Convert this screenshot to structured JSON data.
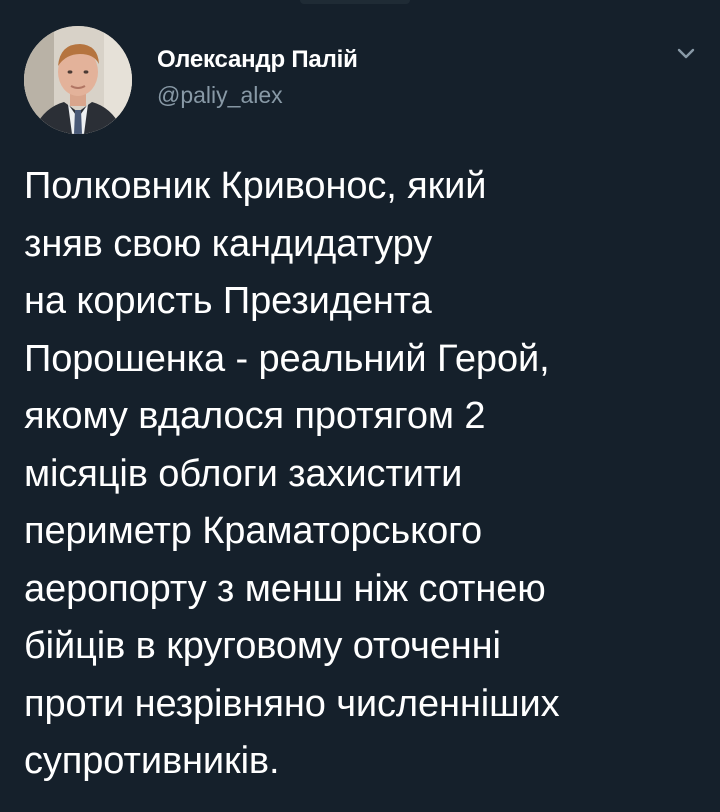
{
  "author": {
    "name": "Олександр Палій",
    "handle": "@paliy_alex",
    "avatar_icon": "user-avatar-photo"
  },
  "menu": {
    "icon": "chevron-down-icon"
  },
  "tweet": {
    "text": "Полковник Кривонос, який\nзняв свою кандидатуру\nна користь Президента\nПорошенка - реальний Герой,\nякому вдалося протягом 2\nмісяців облоги захистити\nпериметр Краматорського\nаеропорту з менш ніж сотнею\nбійців в круговому оточенні\nпроти незрівняно численніших\nсупротивників."
  },
  "theme": {
    "background": "#15202b",
    "text_primary": "#ffffff",
    "text_secondary": "#8899a6"
  }
}
